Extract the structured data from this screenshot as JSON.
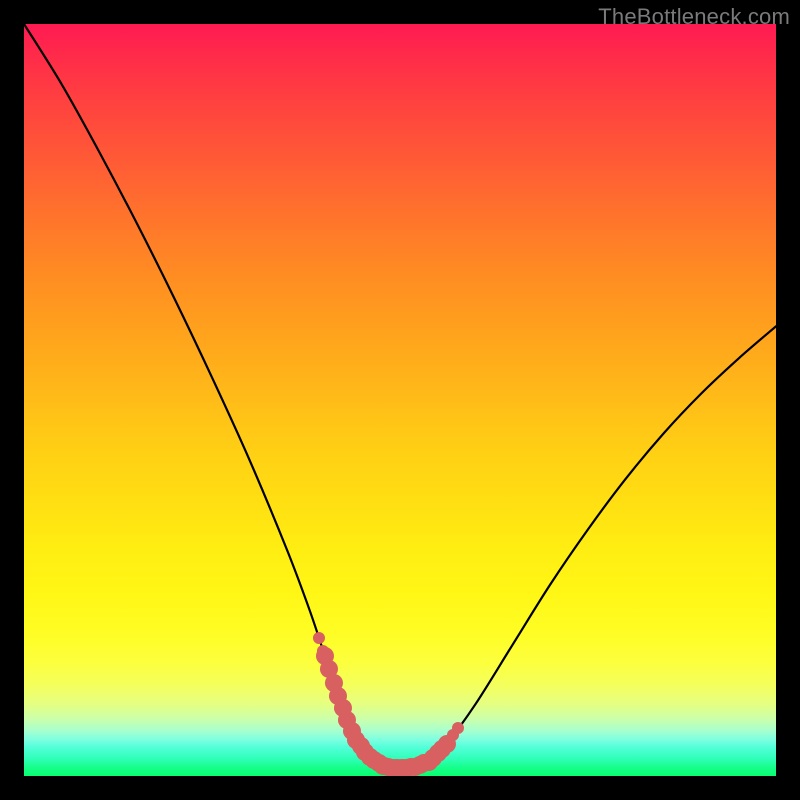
{
  "watermark": {
    "text": "TheBottleneck.com"
  },
  "chart_data": {
    "type": "line",
    "title": "",
    "xlabel": "",
    "ylabel": "",
    "xlim": [
      0,
      1
    ],
    "ylim": [
      0,
      1
    ],
    "grid": false,
    "legend": false,
    "series": [
      {
        "name": "bottleneck-curve",
        "color": "#000000",
        "x": [
          0.0,
          0.05,
          0.1,
          0.15,
          0.2,
          0.25,
          0.3,
          0.35,
          0.38,
          0.4,
          0.42,
          0.44,
          0.46,
          0.48,
          0.5,
          0.52,
          0.54,
          0.56,
          0.6,
          0.65,
          0.7,
          0.75,
          0.8,
          0.85,
          0.9,
          0.95,
          1.0
        ],
        "y": [
          1.0,
          0.92,
          0.83,
          0.735,
          0.635,
          0.53,
          0.42,
          0.3,
          0.22,
          0.16,
          0.1,
          0.05,
          0.025,
          0.012,
          0.01,
          0.012,
          0.02,
          0.04,
          0.095,
          0.175,
          0.255,
          0.328,
          0.395,
          0.455,
          0.508,
          0.555,
          0.598
        ]
      }
    ],
    "markers": {
      "name": "valley-highlight",
      "color": "#d86060",
      "segments": [
        {
          "xrange": [
            0.4,
            0.565
          ],
          "thickness": 0.024
        },
        {
          "xrange": [
            0.392,
            0.4
          ],
          "thickness": 0.016
        },
        {
          "xrange": [
            0.565,
            0.58
          ],
          "thickness": 0.016
        }
      ]
    },
    "background_gradient": {
      "top_color": "#ff1a52",
      "mid_color": "#ffee12",
      "bottom_color": "#08ff6e"
    }
  }
}
